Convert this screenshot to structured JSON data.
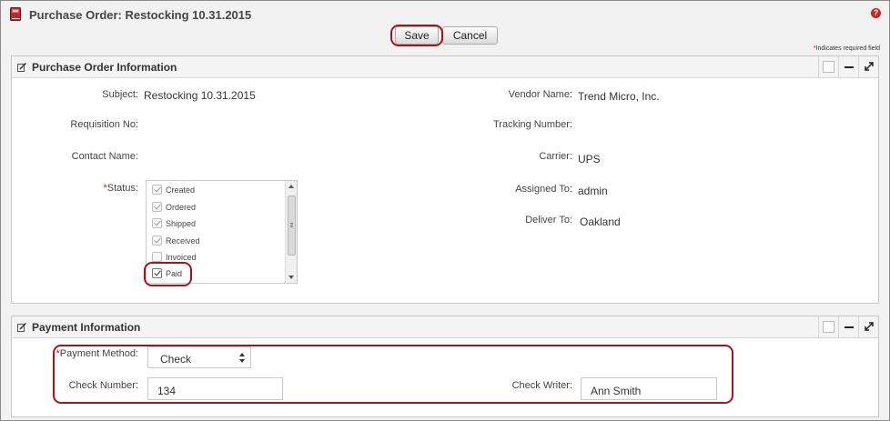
{
  "window": {
    "title": "Purchase Order: Restocking 10.31.2015",
    "help_symbol": "?"
  },
  "toolbar": {
    "save_label": "Save",
    "cancel_label": "Cancel"
  },
  "required_note": {
    "star": "*",
    "text": "Indicates required field"
  },
  "po_panel": {
    "title": "Purchase Order Information",
    "subject_label": "Subject:",
    "subject_value": "Restocking 10.31.2015",
    "requisition_label": "Requisition No:",
    "requisition_value": "",
    "contact_label": "Contact Name:",
    "contact_value": "",
    "status_star": "*",
    "status_label": "Status:",
    "vendor_label": "Vendor Name:",
    "vendor_value": "Trend Micro, Inc.",
    "tracking_label": "Tracking Number:",
    "tracking_value": "",
    "carrier_label": "Carrier:",
    "carrier_value": "UPS",
    "assigned_label": "Assigned To:",
    "assigned_value": "admin",
    "deliver_label": "Deliver To:",
    "deliver_value": "Oakland",
    "status_options": [
      {
        "label": "Created",
        "checked": true
      },
      {
        "label": "Ordered",
        "checked": true
      },
      {
        "label": "Shipped",
        "checked": true
      },
      {
        "label": "Received",
        "checked": true
      },
      {
        "label": "Invoiced",
        "checked": false
      },
      {
        "label": "Paid",
        "checked": true
      }
    ]
  },
  "payment_panel": {
    "title": "Payment Information",
    "method_star": "*",
    "method_label": "Payment Method:",
    "method_value": "Check",
    "check_number_label": "Check Number:",
    "check_number_value": "134",
    "check_writer_label": "Check Writer:",
    "check_writer_value": "Ann Smith"
  },
  "colors": {
    "highlight": "#a4141b",
    "required": "#c0141b",
    "help_icon": "#d21f1f"
  },
  "icons": [
    "book-icon",
    "help-icon",
    "edit-icon",
    "box-icon",
    "minimize-icon",
    "maximize-icon",
    "updown-icon"
  ]
}
